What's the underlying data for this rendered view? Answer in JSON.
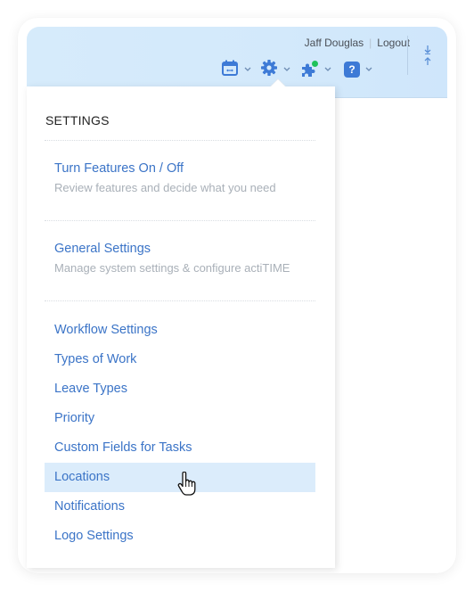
{
  "header": {
    "user_name": "Jaff Douglas",
    "separator": "|",
    "logout_label": "Logout",
    "icons": [
      {
        "name": "calendar-icon",
        "has_dropdown": true
      },
      {
        "name": "gear-icon",
        "has_dropdown": true,
        "active": true
      },
      {
        "name": "puzzle-icon",
        "has_dropdown": true,
        "badge_color": "#1fc25a"
      },
      {
        "name": "help-icon",
        "glyph": "?",
        "has_dropdown": true
      }
    ],
    "collapse_icon": "collapse-arrows-icon"
  },
  "menu": {
    "title": "SETTINGS",
    "sections": [
      {
        "title": "Turn Features On / Off",
        "description": "Review features and decide what you need"
      },
      {
        "title": "General Settings",
        "description": "Manage system settings & configure actiTIME"
      }
    ],
    "items": [
      {
        "label": "Workflow Settings"
      },
      {
        "label": "Types of Work"
      },
      {
        "label": "Leave Types"
      },
      {
        "label": "Priority"
      },
      {
        "label": "Custom Fields for Tasks"
      },
      {
        "label": "Locations",
        "hovered": true
      },
      {
        "label": "Notifications"
      },
      {
        "label": "Logo Settings"
      }
    ]
  },
  "colors": {
    "accent": "#3b74c7",
    "icon_blue": "#3d7ad6",
    "header_bg": "#d5eafb",
    "hover_bg": "#dbecfb",
    "badge_green": "#1fc25a"
  }
}
